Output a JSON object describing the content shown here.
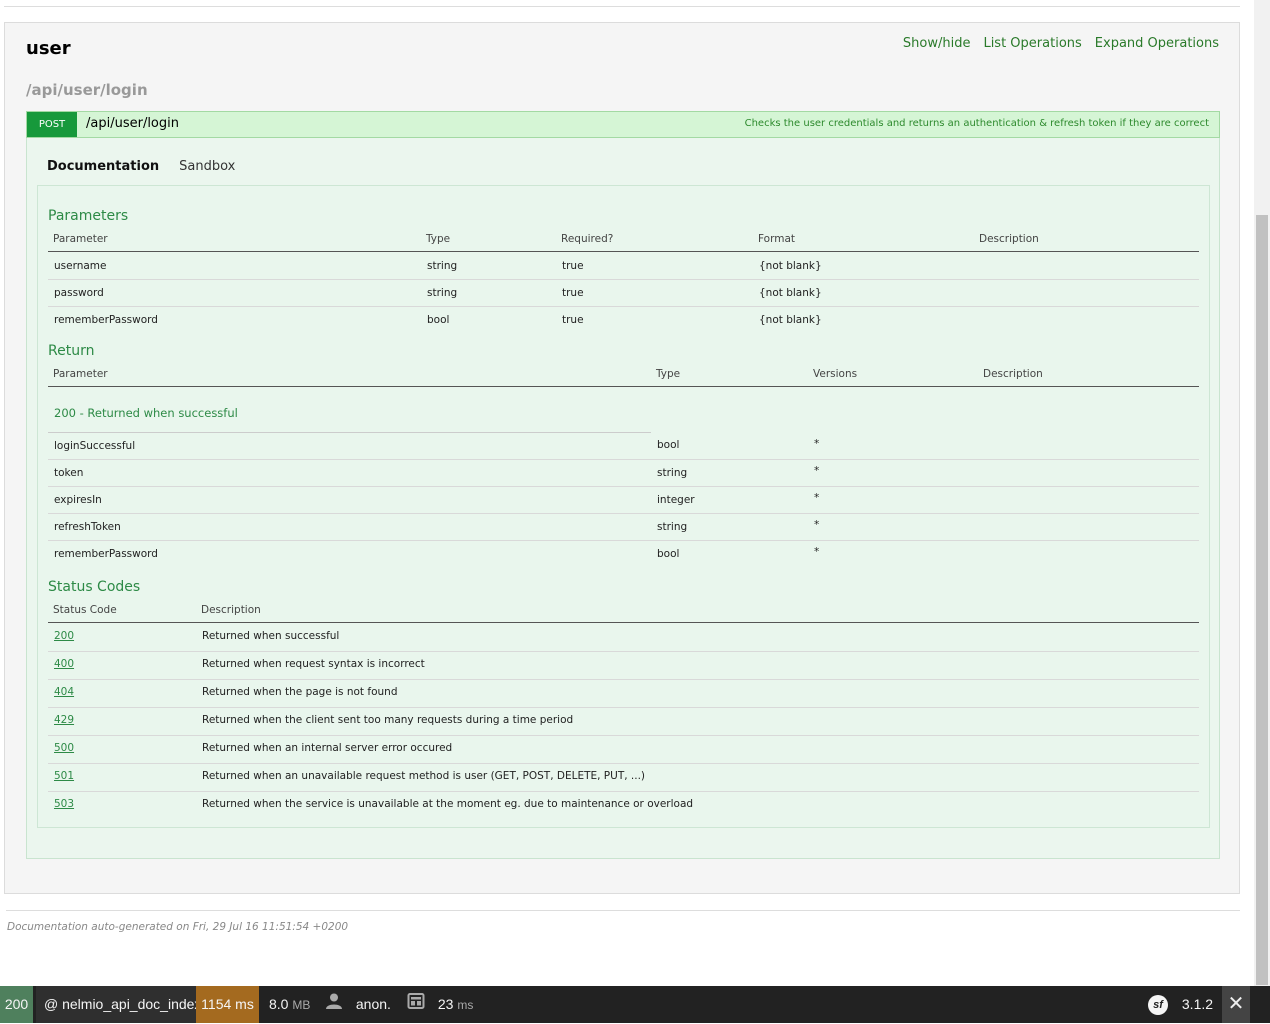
{
  "resource": {
    "title": "user",
    "links": [
      "Show/hide",
      "List Operations",
      "Expand Operations"
    ],
    "path_heading": "/api/user/login"
  },
  "operation": {
    "method": "POST",
    "path": "/api/user/login",
    "summary": "Checks the user credentials and returns an authentication & refresh token if they are correct",
    "tabs": {
      "documentation": "Documentation",
      "sandbox": "Sandbox"
    }
  },
  "parameters": {
    "heading": "Parameters",
    "columns": [
      "Parameter",
      "Type",
      "Required?",
      "Format",
      "Description"
    ],
    "rows": [
      {
        "name": "username",
        "type": "string",
        "required": "true",
        "format": "{not blank}"
      },
      {
        "name": "password",
        "type": "string",
        "required": "true",
        "format": "{not blank}"
      },
      {
        "name": "rememberPassword",
        "type": "bool",
        "required": "true",
        "format": "{not blank}"
      }
    ]
  },
  "return": {
    "heading": "Return",
    "columns": [
      "Parameter",
      "Type",
      "Versions",
      "Description"
    ],
    "subheading": "200 - Returned when successful",
    "rows": [
      {
        "name": "loginSuccessful",
        "type": "bool",
        "versions": "*"
      },
      {
        "name": "token",
        "type": "string",
        "versions": "*"
      },
      {
        "name": "expiresIn",
        "type": "integer",
        "versions": "*"
      },
      {
        "name": "refreshToken",
        "type": "string",
        "versions": "*"
      },
      {
        "name": "rememberPassword",
        "type": "bool",
        "versions": "*"
      }
    ]
  },
  "status_codes": {
    "heading": "Status Codes",
    "columns": [
      "Status Code",
      "Description"
    ],
    "rows": [
      {
        "code": "200",
        "description": "Returned when successful"
      },
      {
        "code": "400",
        "description": "Returned when request syntax is incorrect"
      },
      {
        "code": "404",
        "description": "Returned when the page is not found"
      },
      {
        "code": "429",
        "description": "Returned when the client sent too many requests during a time period"
      },
      {
        "code": "500",
        "description": "Returned when an internal server error occured"
      },
      {
        "code": "501",
        "description": "Returned when an unavailable request method is user (GET, POST, DELETE, PUT, ...)"
      },
      {
        "code": "503",
        "description": "Returned when the service is unavailable at the moment eg. due to maintenance or overload"
      }
    ]
  },
  "footer": {
    "text": "Documentation auto-generated on Fri, 29 Jul 16 11:51:54 +0200"
  },
  "toolbar": {
    "status": "200",
    "route": "@ nelmio_api_doc_index",
    "time": "1154 ms",
    "memory_value": "8.0",
    "memory_unit": "MB",
    "user": "anon.",
    "db_value": "23",
    "db_unit": "ms",
    "sf_logo": "sf",
    "sf_version": "3.1.2",
    "close": "✕"
  },
  "colors": {
    "post": "#17993b",
    "op_bg": "#d5f5d5",
    "toolbar": "#222222",
    "time_badge": "#a46a1f",
    "status_badge": "#4f805d"
  }
}
